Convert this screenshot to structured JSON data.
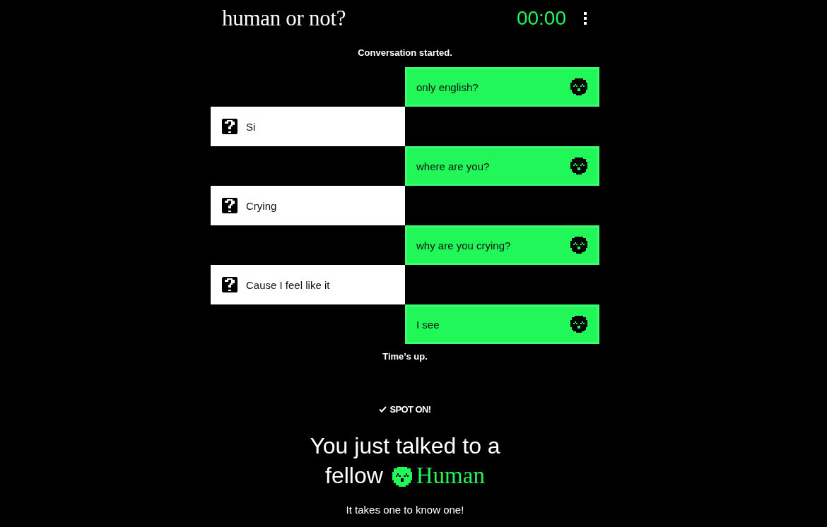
{
  "header": {
    "title": "human or not?",
    "timer": "00:00"
  },
  "chat": {
    "start_note": "Conversation started.",
    "messages": [
      {
        "kind": "sent",
        "text": "only english?"
      },
      {
        "kind": "received",
        "text": "Si"
      },
      {
        "kind": "sent",
        "text": "where are you?"
      },
      {
        "kind": "received",
        "text": "Crying"
      },
      {
        "kind": "sent",
        "text": "why are you crying?"
      },
      {
        "kind": "received",
        "text": "Cause I feel like it"
      },
      {
        "kind": "sent",
        "text": "I see"
      }
    ],
    "end_note": "Time’s up."
  },
  "result": {
    "verdict": "SPOT ON!",
    "headline": "You just talked to a fellow",
    "answer": "Human",
    "note": "It takes one to know one!"
  }
}
